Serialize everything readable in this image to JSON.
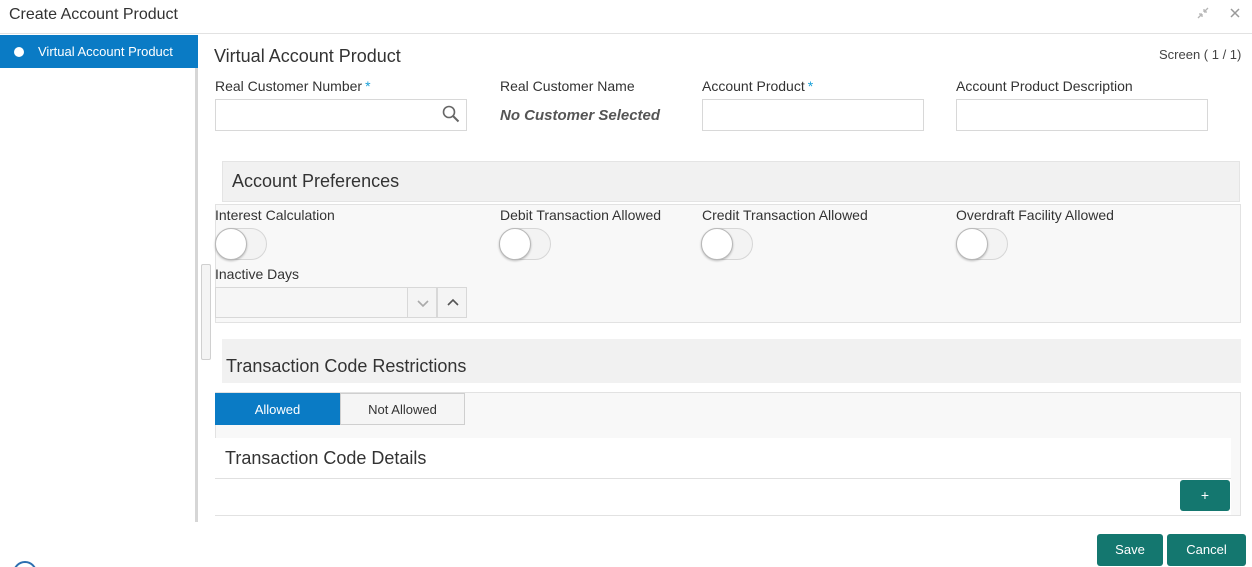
{
  "window": {
    "title": "Create Account Product",
    "minimize_glyph": "↘↖",
    "close_glyph": "✕"
  },
  "sidebar": {
    "items": [
      {
        "label": "Virtual Account Product",
        "active": true
      }
    ]
  },
  "main": {
    "title": "Virtual Account Product",
    "screen_count": "Screen ( 1 / 1)",
    "fields": {
      "real_customer_number": {
        "label": "Real Customer Number",
        "value": "",
        "required": true,
        "required_mark": "*"
      },
      "real_customer_name": {
        "label": "Real Customer Name",
        "value": "No Customer Selected"
      },
      "account_product": {
        "label": "Account Product",
        "value": "",
        "required": true,
        "required_mark": "*"
      },
      "account_product_description": {
        "label": "Account Product Description",
        "value": ""
      }
    }
  },
  "account_preferences": {
    "title": "Account Preferences",
    "toggles": [
      {
        "label": "Interest Calculation",
        "on": false
      },
      {
        "label": "Debit Transaction Allowed",
        "on": false
      },
      {
        "label": "Credit Transaction Allowed",
        "on": false
      },
      {
        "label": "Overdraft Facility Allowed",
        "on": false
      }
    ],
    "inactive_days": {
      "label": "Inactive Days",
      "value": ""
    }
  },
  "transaction_code_restrictions": {
    "title": "Transaction Code Restrictions",
    "tabs": [
      {
        "label": "Allowed",
        "active": true
      },
      {
        "label": "Not Allowed",
        "active": false
      }
    ],
    "details_title": "Transaction Code Details",
    "add_label": "+"
  },
  "footer": {
    "save_label": "Save",
    "cancel_label": "Cancel"
  },
  "colors": {
    "primary_blue": "#0a7bc5",
    "action_green": "#14776f",
    "required_asterisk": "#19a0d8"
  },
  "icons": [
    "search-icon",
    "chevron-down-icon",
    "chevron-up-icon",
    "close-icon",
    "minimize-icon"
  ]
}
